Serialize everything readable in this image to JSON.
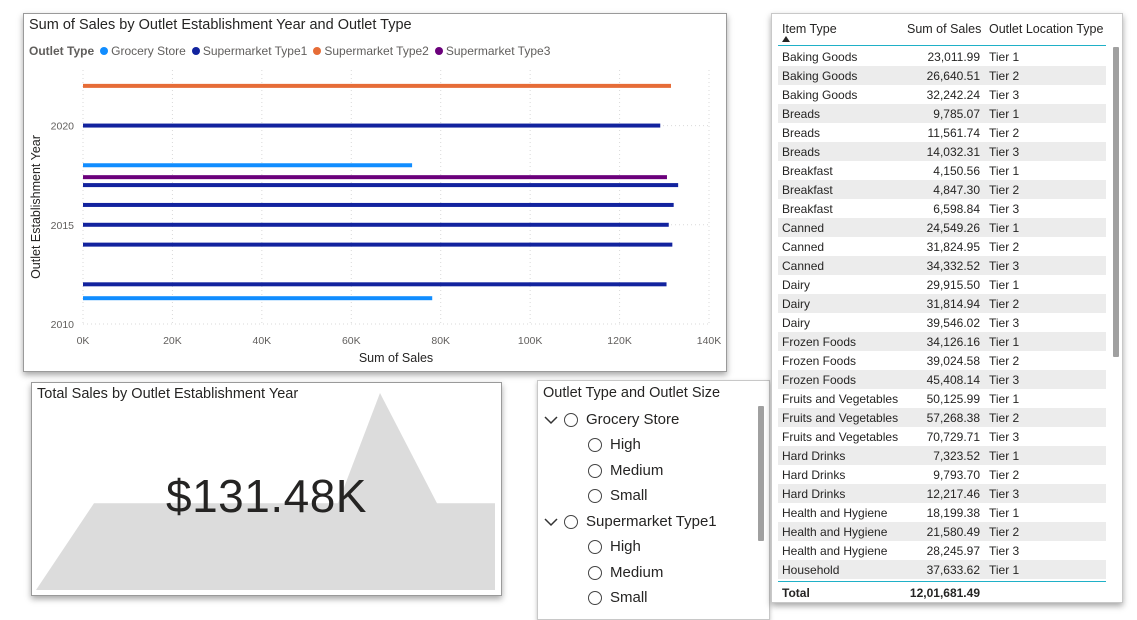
{
  "colors": {
    "grocery_store": "#118DFF",
    "supermarket_type1": "#12239E",
    "supermarket_type2": "#E66C37",
    "supermarket_type3": "#6B007B",
    "area_fill": "#dcdcdc",
    "table_accent": "#1fb0c7"
  },
  "bar_chart": {
    "title": "Sum of Sales by Outlet Establishment Year and Outlet Type",
    "legend_title": "Outlet Type",
    "legend": [
      {
        "label": "Grocery Store",
        "color_key": "grocery_store"
      },
      {
        "label": "Supermarket Type1",
        "color_key": "supermarket_type1"
      },
      {
        "label": "Supermarket Type2",
        "color_key": "supermarket_type2"
      },
      {
        "label": "Supermarket Type3",
        "color_key": "supermarket_type3"
      }
    ]
  },
  "chart_data": {
    "type": "bar",
    "orientation": "horizontal",
    "title": "Sum of Sales by Outlet Establishment Year and Outlet Type",
    "xlabel": "Sum of Sales",
    "ylabel": "Outlet Establishment Year",
    "xlim": [
      0,
      140000
    ],
    "ylim": [
      2010,
      2022.8
    ],
    "x_ticks": [
      "0K",
      "20K",
      "40K",
      "60K",
      "80K",
      "100K",
      "120K",
      "140K"
    ],
    "y_ticks": [
      "2010",
      "2015",
      "2020"
    ],
    "grid": "dotted vertical and horizontal",
    "legend_position": "top-left",
    "bars": [
      {
        "year": 2022,
        "series": "Supermarket Type2",
        "value": 131500
      },
      {
        "year": 2020,
        "series": "Supermarket Type1",
        "value": 129100
      },
      {
        "year": 2018,
        "series": "Grocery Store",
        "value": 73600
      },
      {
        "year": 2017.4,
        "series": "Supermarket Type3",
        "value": 130600
      },
      {
        "year": 2017,
        "series": "Supermarket Type1",
        "value": 133100
      },
      {
        "year": 2016,
        "series": "Supermarket Type1",
        "value": 132100
      },
      {
        "year": 2015,
        "series": "Supermarket Type1",
        "value": 131000
      },
      {
        "year": 2014,
        "series": "Supermarket Type1",
        "value": 131800
      },
      {
        "year": 2012,
        "series": "Supermarket Type1",
        "value": 130500
      },
      {
        "year": 2011.3,
        "series": "Grocery Store",
        "value": 78100
      }
    ]
  },
  "area_card": {
    "title": "Total Sales by Outlet Establishment Year",
    "value": "$131.48K",
    "area_values": [
      0,
      130,
      130,
      295,
      130,
      130
    ]
  },
  "slicer": {
    "title": "Outlet Type and Outlet Size",
    "groups": [
      {
        "label": "Grocery Store",
        "children": [
          "High",
          "Medium",
          "Small"
        ]
      },
      {
        "label": "Supermarket Type1",
        "children": [
          "High",
          "Medium",
          "Small"
        ]
      }
    ]
  },
  "table": {
    "headers": [
      "Item Type",
      "Sum of Sales",
      "Outlet Location Type"
    ],
    "rows": [
      [
        "Baking Goods",
        "23,011.99",
        "Tier 1"
      ],
      [
        "Baking Goods",
        "26,640.51",
        "Tier 2"
      ],
      [
        "Baking Goods",
        "32,242.24",
        "Tier 3"
      ],
      [
        "Breads",
        "9,785.07",
        "Tier 1"
      ],
      [
        "Breads",
        "11,561.74",
        "Tier 2"
      ],
      [
        "Breads",
        "14,032.31",
        "Tier 3"
      ],
      [
        "Breakfast",
        "4,150.56",
        "Tier 1"
      ],
      [
        "Breakfast",
        "4,847.30",
        "Tier 2"
      ],
      [
        "Breakfast",
        "6,598.84",
        "Tier 3"
      ],
      [
        "Canned",
        "24,549.26",
        "Tier 1"
      ],
      [
        "Canned",
        "31,824.95",
        "Tier 2"
      ],
      [
        "Canned",
        "34,332.52",
        "Tier 3"
      ],
      [
        "Dairy",
        "29,915.50",
        "Tier 1"
      ],
      [
        "Dairy",
        "31,814.94",
        "Tier 2"
      ],
      [
        "Dairy",
        "39,546.02",
        "Tier 3"
      ],
      [
        "Frozen Foods",
        "34,126.16",
        "Tier 1"
      ],
      [
        "Frozen Foods",
        "39,024.58",
        "Tier 2"
      ],
      [
        "Frozen Foods",
        "45,408.14",
        "Tier 3"
      ],
      [
        "Fruits and Vegetables",
        "50,125.99",
        "Tier 1"
      ],
      [
        "Fruits and Vegetables",
        "57,268.38",
        "Tier 2"
      ],
      [
        "Fruits and Vegetables",
        "70,729.71",
        "Tier 3"
      ],
      [
        "Hard Drinks",
        "7,323.52",
        "Tier 1"
      ],
      [
        "Hard Drinks",
        "9,793.70",
        "Tier 2"
      ],
      [
        "Hard Drinks",
        "12,217.46",
        "Tier 3"
      ],
      [
        "Health and Hygiene",
        "18,199.38",
        "Tier 1"
      ],
      [
        "Health and Hygiene",
        "21,580.49",
        "Tier 2"
      ],
      [
        "Health and Hygiene",
        "28,245.97",
        "Tier 3"
      ],
      [
        "Household",
        "37,633.62",
        "Tier 1"
      ]
    ],
    "total_label": "Total",
    "total_value": "12,01,681.49"
  }
}
